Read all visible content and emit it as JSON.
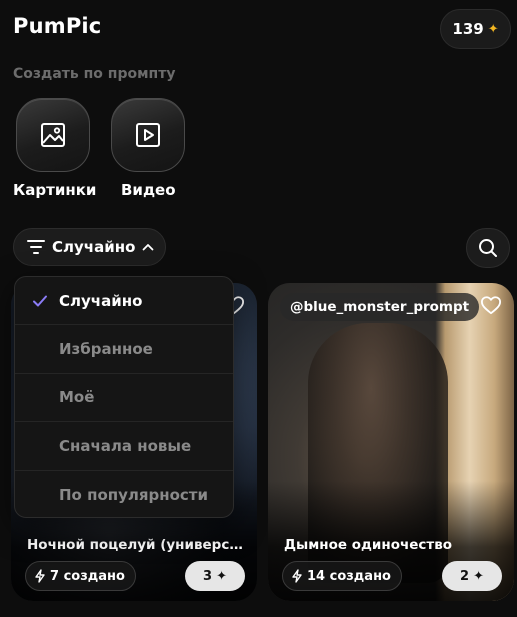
{
  "header": {
    "app_title": "PumPic",
    "credits": "139",
    "credits_icon": "sparkle-icon"
  },
  "create": {
    "section_label": "Создать по промпту",
    "images_label": "Картинки",
    "video_label": "Видео"
  },
  "sort": {
    "label": "Случайно",
    "options": [
      {
        "label": "Случайно",
        "selected": true
      },
      {
        "label": "Избранное",
        "selected": false
      },
      {
        "label": "Моё",
        "selected": false
      },
      {
        "label": "Сначала новые",
        "selected": false
      },
      {
        "label": "По популярности",
        "selected": false
      }
    ]
  },
  "cards": [
    {
      "author": "",
      "title": "Ночной поцелуй (универса...",
      "created": "7 создано",
      "cost": "3"
    },
    {
      "author": "@blue_monster_prompt",
      "title": "Дымное одиночество",
      "created": "14 создано",
      "cost": "2"
    }
  ],
  "colors": {
    "accent_check": "#8b7cf6",
    "credit_star": "#f2b622",
    "background": "#0d0d0d"
  }
}
